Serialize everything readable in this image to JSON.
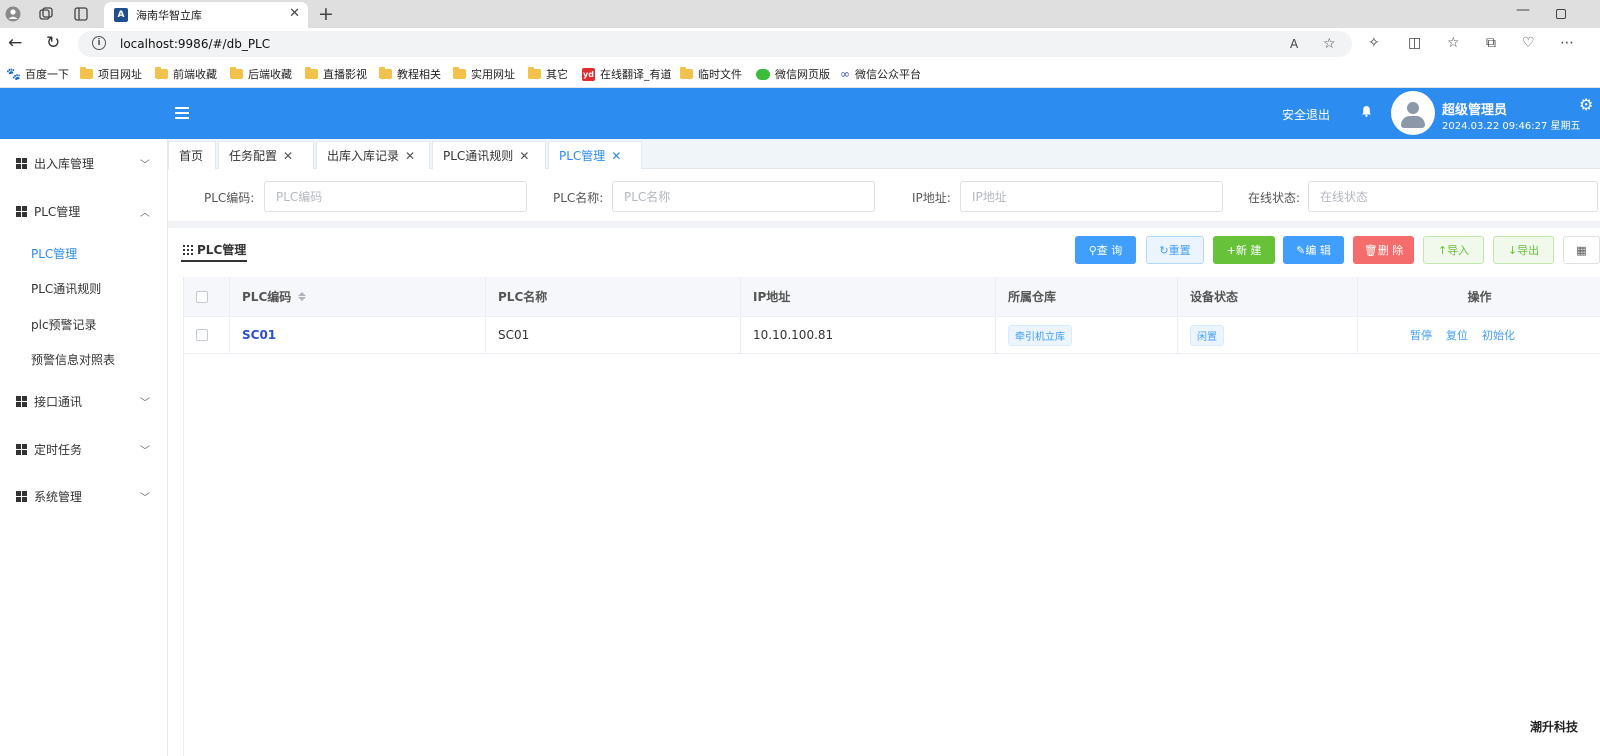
{
  "browser": {
    "tab_title": "海南华智立库",
    "tab_close": "✕",
    "new_tab": "+",
    "minimize": "—",
    "url": "localhost:9986/#/db_PLC",
    "bookmarks": [
      {
        "label": "百度一下",
        "icon": "paw-icon"
      },
      {
        "label": "项目网址",
        "icon": "folder-icon"
      },
      {
        "label": "前端收藏",
        "icon": "folder-icon"
      },
      {
        "label": "后端收藏",
        "icon": "folder-icon"
      },
      {
        "label": "直播影视",
        "icon": "folder-icon"
      },
      {
        "label": "教程相关",
        "icon": "folder-icon"
      },
      {
        "label": "实用网址",
        "icon": "folder-icon"
      },
      {
        "label": "其它",
        "icon": "folder-icon"
      },
      {
        "label": "在线翻译_有道",
        "icon": "youdao-icon"
      },
      {
        "label": "临时文件",
        "icon": "folder-icon"
      },
      {
        "label": "微信网页版",
        "icon": "wechat-icon"
      },
      {
        "label": "微信公众平台",
        "icon": "link-icon"
      }
    ]
  },
  "header": {
    "logout_label": "安全退出",
    "user_name": "超级管理员",
    "datetime": "2024.03.22 09:46:27 星期五",
    "bg_color": "#2d8cf0"
  },
  "sidebar": {
    "items": [
      {
        "label": "出入库管理",
        "expanded": false
      },
      {
        "label": "PLC管理",
        "expanded": true,
        "children": [
          "PLC管理",
          "PLC通讯规则",
          "plc预警记录",
          "预警信息对照表"
        ]
      },
      {
        "label": "接口通讯",
        "expanded": false
      },
      {
        "label": "定时任务",
        "expanded": false
      },
      {
        "label": "系统管理",
        "expanded": false
      }
    ],
    "active_child": "PLC管理"
  },
  "page_tabs": [
    {
      "label": "首页",
      "closable": false
    },
    {
      "label": "任务配置",
      "closable": true
    },
    {
      "label": "出库入库记录",
      "closable": true
    },
    {
      "label": "PLC通讯规则",
      "closable": true
    },
    {
      "label": "PLC管理",
      "closable": true,
      "active": true
    }
  ],
  "filter": {
    "plc_code": {
      "label": "PLC编码:",
      "placeholder": "PLC编码",
      "value": ""
    },
    "plc_name": {
      "label": "PLC名称:",
      "placeholder": "PLC名称",
      "value": ""
    },
    "ip": {
      "label": "IP地址:",
      "placeholder": "IP地址",
      "value": ""
    },
    "online_status": {
      "label": "在线状态:",
      "placeholder": "在线状态",
      "value": ""
    }
  },
  "toolbar": {
    "title": "PLC管理",
    "query": "查 询",
    "reset": "重置",
    "add": "新 建",
    "edit": "编 辑",
    "delete": "删 除",
    "import": "导入",
    "export": "导出"
  },
  "table": {
    "headers": [
      "PLC编码",
      "PLC名称",
      "IP地址",
      "所属仓库",
      "设备状态",
      "操作"
    ],
    "rows": [
      {
        "code": "SC01",
        "name": "SC01",
        "ip": "10.10.100.81",
        "warehouse": "牵引机立库",
        "status": "闲置",
        "actions": [
          "暂停",
          "复位",
          "初始化"
        ]
      }
    ]
  },
  "watermark": "潮升科技"
}
